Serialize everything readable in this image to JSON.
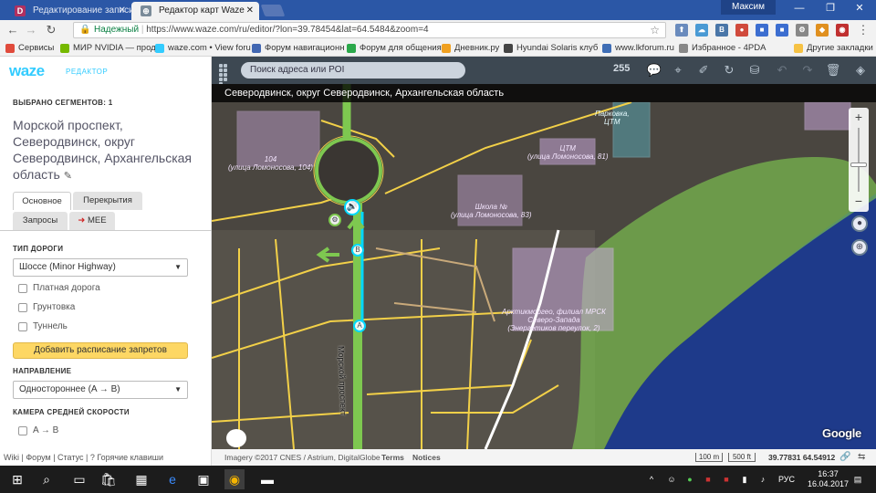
{
  "browser": {
    "tabs": [
      {
        "label": "Редактирование записи",
        "icon": "D",
        "icon_color": "#b03060",
        "active": false
      },
      {
        "label": "Редактор карт Waze",
        "icon": "⊕",
        "icon_color": "#7a8b99",
        "active": true
      }
    ],
    "user": "Максим",
    "secure_label": "Надежный",
    "url": "https://www.waze.com/ru/editor/?lon=39.78454&lat=64.5484&zoom=4",
    "bookmarks": [
      {
        "label": "Сервисы",
        "color": "#e04b3c"
      },
      {
        "label": "МИР NVIDIA — прод",
        "color": "#76b900"
      },
      {
        "label": "waze.com • View foru",
        "color": "#33ccff"
      },
      {
        "label": "Форум навигационн",
        "color": "#4267b2"
      },
      {
        "label": "Форум для общения",
        "color": "#2aa84a"
      },
      {
        "label": "Дневник.ру",
        "color": "#f0a020"
      },
      {
        "label": "Hyundai Solaris клуб",
        "color": "#444"
      },
      {
        "label": "www.lkforum.ru",
        "color": "#3e6db5"
      },
      {
        "label": "Избранное - 4PDA",
        "color": "#888"
      },
      {
        "label": "Другие закладки",
        "color": "#f6c244"
      }
    ]
  },
  "waze": {
    "logo": "waze",
    "logo_sub": "РЕДАКТОР",
    "selected_count_label": "ВЫБРАНО СЕГМЕНТОВ: 1",
    "segment_title": "Морской проспект, Северодвинск, округ Северодвинск, Архангельская область",
    "tabs": [
      "Основное",
      "Перекрытия",
      "Запросы",
      "MEE"
    ],
    "road_type_label": "ТИП ДОРОГИ",
    "road_type_value": "Шоссе (Minor Highway)",
    "checkboxes": [
      "Платная дорога",
      "Грунтовка",
      "Туннель"
    ],
    "schedule_button": "Добавить расписание запретов",
    "direction_label": "НАПРАВЛЕНИЕ",
    "direction_value": "Одностороннее (A → B)",
    "speed_camera_label": "КАМЕРА СРЕДНЕЙ СКОРОСТИ",
    "speed_camera_option": "A → B",
    "footer_links": [
      "Wiki",
      "Форум",
      "Статус",
      "Горячие клавиши"
    ],
    "search_placeholder": "Поиск адреса или POI",
    "counter": "255",
    "map_title": "Северодвинск, округ Северодвинск, Архангельская область",
    "map_footer_credit": "Imagery ©2017 CNES / Astrium, DigitalGlobe",
    "map_footer_terms": "Terms",
    "map_footer_notices": "Notices",
    "scale_m": "100 m",
    "scale_ft": "500 ft",
    "coords": "39.77831 64.54912",
    "google": "Google",
    "street_label": "Морской проспект",
    "node_a": "A",
    "node_b": "B",
    "building_labels": [
      "104\n(улица Ломоносова, 104)",
      "ЦТМ\n(улица Ломоносова, 81)",
      "Школа №\n(улица Ломоносова, 83)",
      "Арктикморгео, филиал МРСК\nСеверо-Запада\n(Энергетиков переулок, 2)",
      "Парковка,\nЦТМ"
    ]
  },
  "taskbar": {
    "time": "16:37",
    "date": "16.04.2017",
    "lang": "РУС"
  }
}
